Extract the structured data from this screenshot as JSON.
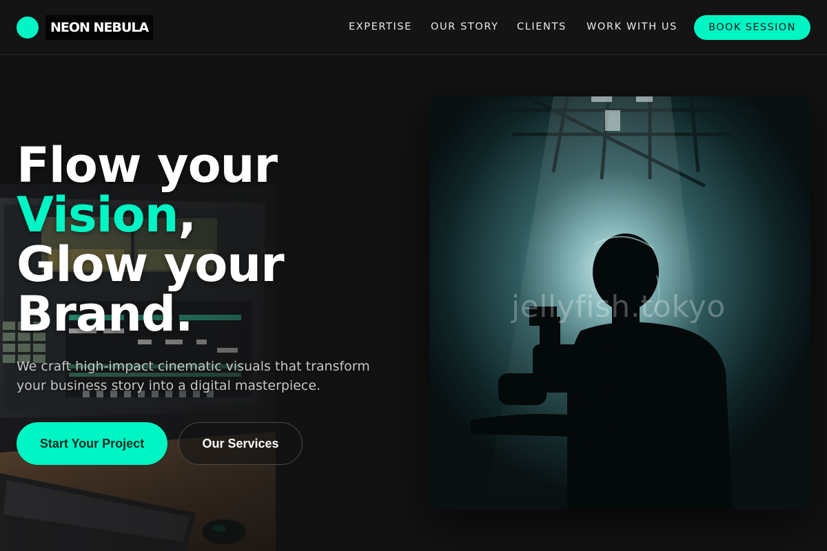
{
  "brand": {
    "name": "NEON NEBULA"
  },
  "nav": {
    "items": [
      "EXPERTISE",
      "OUR STORY",
      "CLIENTS",
      "WORK WITH US"
    ],
    "cta": "BOOK SESSION"
  },
  "hero": {
    "line1": "Flow your",
    "accent_word": "Vision",
    "accent_punct": ",",
    "line3": "Glow your",
    "line4": "Brand.",
    "subtitle_line1": "We craft high-impact cinematic visuals that transform",
    "subtitle_line2": "your business story into a digital masterpiece.",
    "primary_cta": "Start Your Project",
    "secondary_cta": "Our Services"
  },
  "image": {
    "watermark": "jellyfish.tokyo"
  },
  "colors": {
    "accent": "#00f5c4",
    "background": "#121212",
    "header": "#141414"
  },
  "icons": {
    "logo": "circle-logo-icon"
  }
}
